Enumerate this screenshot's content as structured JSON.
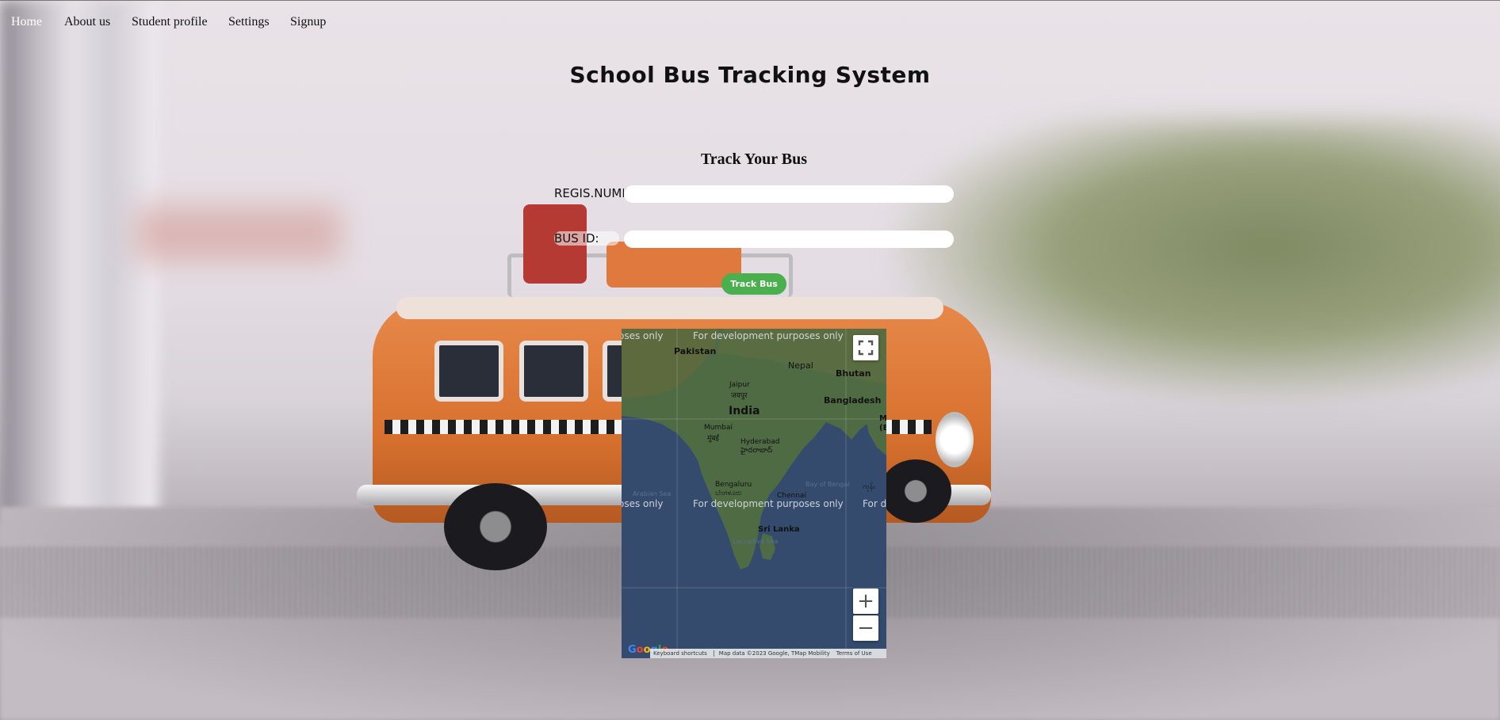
{
  "nav": {
    "items": [
      {
        "label": "Home",
        "active": true
      },
      {
        "label": "About us"
      },
      {
        "label": "Student profile"
      },
      {
        "label": "Settings"
      },
      {
        "label": "Signup"
      }
    ]
  },
  "page_title": "School Bus Tracking System",
  "form": {
    "title": "Track Your Bus",
    "regis_label": "REGIS.NUMBER:",
    "regis_value": "",
    "busid_label": "BUS ID:",
    "busid_value": "",
    "submit_label": "Track Bus",
    "submit_color": "#49b04d"
  },
  "map": {
    "dev_watermark": "For development purposes only",
    "dev_partial_left": "oses only",
    "dev_partial_right": "For d",
    "labels": {
      "pakistan": "Pakistan",
      "nepal": "Nepal",
      "bhutan": "Bhutan",
      "bangladesh": "Bangladesh",
      "india": "India",
      "jaipur": "Jaipur",
      "jaipur_local": "जयपुर",
      "mumbai": "Mumbai",
      "mumbai_local": "मुंबई",
      "hyderabad": "Hyderabad",
      "hyderabad_local": "హైదరాబాద్",
      "bengaluru": "Bengaluru",
      "bengaluru_local": "ಬೆಂಗಳೂರು",
      "chennai": "Chennai",
      "sri_lanka": "Sri Lanka",
      "bay_of_bengal": "Bay of Bengal",
      "arabian_sea": "Arabian Sea",
      "laccadive_sea": "Laccadive Sea",
      "edge_right_top": "M",
      "edge_right_top2": "(B",
      "edge_right_mid": "ကုန်း"
    },
    "fullscreen_icon": "fullscreen-icon",
    "zoom_in": "+",
    "zoom_out": "−",
    "logo": "Google",
    "footer": {
      "shortcuts": "Keyboard shortcuts",
      "data": "Map data ©2023 Google, TMap Mobility",
      "terms": "Terms of Use"
    }
  }
}
